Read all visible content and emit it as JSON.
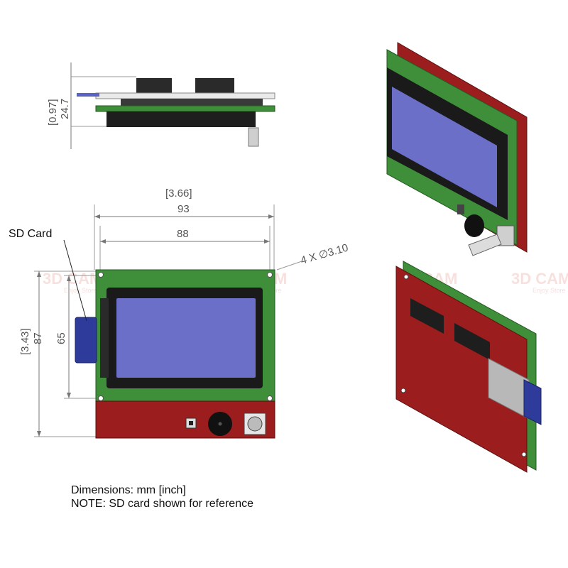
{
  "colors": {
    "pcb_green": "#3f8f3a",
    "pcb_red": "#9b1d1d",
    "lcd_screen": "#6b6fc8",
    "lcd_bezel": "#1a1a1a",
    "sd_card": "#2e3b9a",
    "dimension_line": "#777777"
  },
  "front_view": {
    "width_inch": "[3.66]",
    "width_mm": "93",
    "inner_width_mm": "88",
    "height_inch": "[3.43]",
    "height_mm": "87",
    "hole_spacing_mm": "65",
    "holes_label": "4 X ∅3.10",
    "sd_label": "SD Card"
  },
  "side_view": {
    "thickness_inch": "[0.97]",
    "thickness_mm": "24.7"
  },
  "notes": {
    "line1": "Dimensions: mm [inch]",
    "line2": "NOTE: SD card shown for reference"
  },
  "watermark": {
    "text": "3D CAM",
    "sub": "Enjoy Store"
  }
}
